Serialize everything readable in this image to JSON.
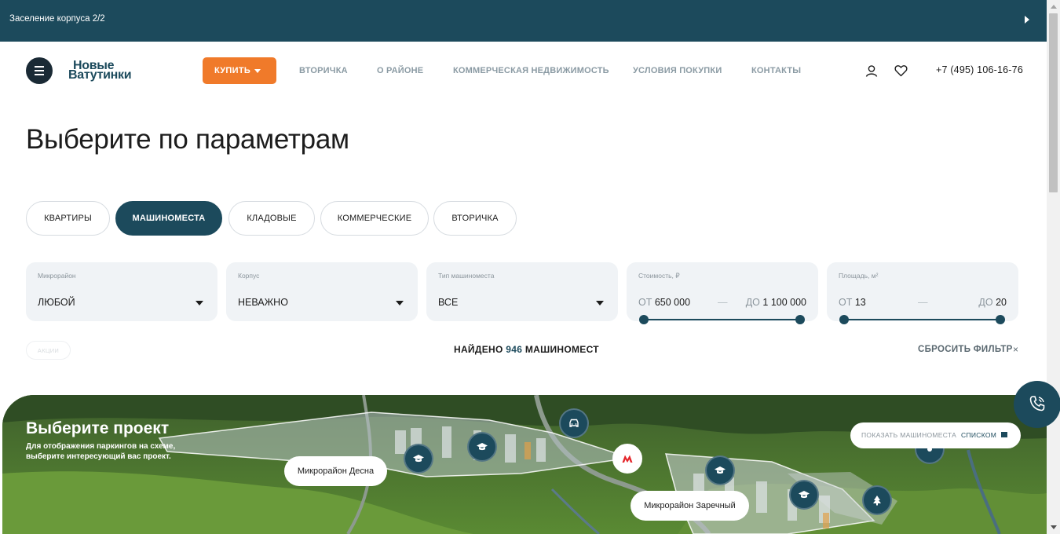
{
  "topbar": {
    "notice": "Заселение корпуса 2/2"
  },
  "header": {
    "logo_line1": "Новые",
    "logo_line2": "Ватутинки",
    "buy_label": "КУПИТЬ",
    "nav": [
      "ВТОРИЧКА",
      "О РАЙОНЕ",
      "КОММЕРЧЕСКАЯ НЕДВИЖИМОСТЬ",
      "УСЛОВИЯ ПОКУПКИ",
      "КОНТАКТЫ"
    ],
    "phone": "+7 (495) 106-16-76"
  },
  "page": {
    "title": "Выберите по параметрам"
  },
  "tabs": [
    {
      "label": "КВАРТИРЫ",
      "active": false
    },
    {
      "label": "МАШИНОМЕСТА",
      "active": true
    },
    {
      "label": "КЛАДОВЫЕ",
      "active": false
    },
    {
      "label": "КОММЕРЧЕСКИЕ",
      "active": false
    },
    {
      "label": "ВТОРИЧКА",
      "active": false
    }
  ],
  "filters": {
    "district": {
      "label": "Микрорайон",
      "value": "ЛЮБОЙ"
    },
    "building": {
      "label": "Корпус",
      "value": "НЕВАЖНО"
    },
    "parking_type": {
      "label": "Тип машиноместа",
      "value": "ВСЕ"
    },
    "price": {
      "label": "Стоимость, ₽",
      "from_prefix": "ОТ",
      "from": "650 000",
      "separator": "—",
      "to_prefix": "ДО",
      "to": "1 100 000"
    },
    "area": {
      "label": "Площадь, м²",
      "from_prefix": "ОТ",
      "from": "13",
      "separator": "—",
      "to_prefix": "ДО",
      "to": "20"
    }
  },
  "results": {
    "promo_tag": "АКЦИИ",
    "found_prefix": "НАЙДЕНО",
    "found_count": "946",
    "found_suffix": "МАШИНОМЕСТ",
    "reset_label": "СБРОСИТЬ ФИЛЬТР",
    "reset_icon": "×"
  },
  "map": {
    "title": "Выберите проект",
    "subtitle": "Для отображения паркингов на схеме, выберите интересующий вас проект.",
    "districts": [
      "Микрорайон Десна",
      "Микрорайон Заречный"
    ],
    "list_button_text": "ПОКАЗАТЬ МАШИНОМЕСТА",
    "list_button_accent": "СПИСКОМ"
  },
  "colors": {
    "primary": "#1c4a5c",
    "accent": "#f07a2a",
    "filter_bg": "#f0f3f6"
  }
}
